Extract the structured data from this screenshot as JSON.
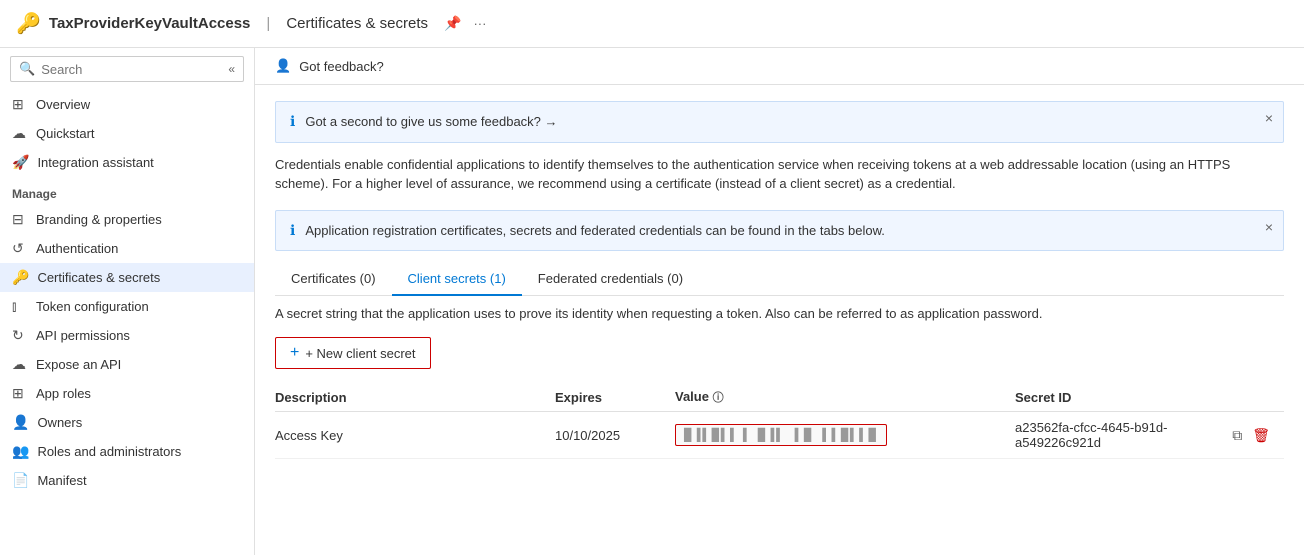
{
  "header": {
    "app_name": "TaxProviderKeyVaultAccess",
    "separator": "|",
    "page_title": "Certificates & secrets",
    "pin_icon": "📌",
    "more_icon": "..."
  },
  "sidebar": {
    "search_placeholder": "Search",
    "items_top": [
      {
        "id": "overview",
        "label": "Overview",
        "icon": "⊞"
      },
      {
        "id": "quickstart",
        "label": "Quickstart",
        "icon": "☁"
      },
      {
        "id": "integration",
        "label": "Integration assistant",
        "icon": "🚀"
      }
    ],
    "manage_label": "Manage",
    "items_manage": [
      {
        "id": "branding",
        "label": "Branding & properties",
        "icon": "⊟"
      },
      {
        "id": "authentication",
        "label": "Authentication",
        "icon": "↺"
      },
      {
        "id": "certificates",
        "label": "Certificates & secrets",
        "icon": "🔑",
        "active": true
      },
      {
        "id": "token",
        "label": "Token configuration",
        "icon": "|||"
      },
      {
        "id": "api",
        "label": "API permissions",
        "icon": "↻"
      },
      {
        "id": "expose",
        "label": "Expose an API",
        "icon": "☁"
      },
      {
        "id": "approles",
        "label": "App roles",
        "icon": "⊞"
      },
      {
        "id": "owners",
        "label": "Owners",
        "icon": "👤"
      },
      {
        "id": "roles",
        "label": "Roles and administrators",
        "icon": "👥"
      },
      {
        "id": "manifest",
        "label": "Manifest",
        "icon": "📄"
      }
    ]
  },
  "content": {
    "feedback": {
      "icon": "👤",
      "text": "Got feedback?"
    },
    "banner1": {
      "text": "Got a second to give us some feedback? →",
      "close": "×"
    },
    "credentials_desc": "Credentials enable confidential applications to identify themselves to the authentication service when receiving tokens at a web addressable location (using an HTTPS scheme). For a higher level of assurance, we recommend using a certificate (instead of a client secret) as a credential.",
    "banner2": {
      "text": "Application registration certificates, secrets and federated credentials can be found in the tabs below.",
      "close": "×"
    },
    "tabs": [
      {
        "id": "certificates",
        "label": "Certificates (0)",
        "active": false
      },
      {
        "id": "client_secrets",
        "label": "Client secrets (1)",
        "active": true
      },
      {
        "id": "federated",
        "label": "Federated credentials (0)",
        "active": false
      }
    ],
    "tab_desc": "A secret string that the application uses to prove its identity when requesting a token. Also can be referred to as application password.",
    "new_secret_btn": "+ New client secret",
    "table": {
      "headers": [
        "Description",
        "Expires",
        "Value",
        "Secret ID"
      ],
      "rows": [
        {
          "description": "Access Key",
          "expires": "10/10/2025",
          "value": "████ █████ ██ ██████",
          "secret_id": "a23562fa-cfcc-4645-b91d-a549226c921d"
        }
      ]
    }
  }
}
